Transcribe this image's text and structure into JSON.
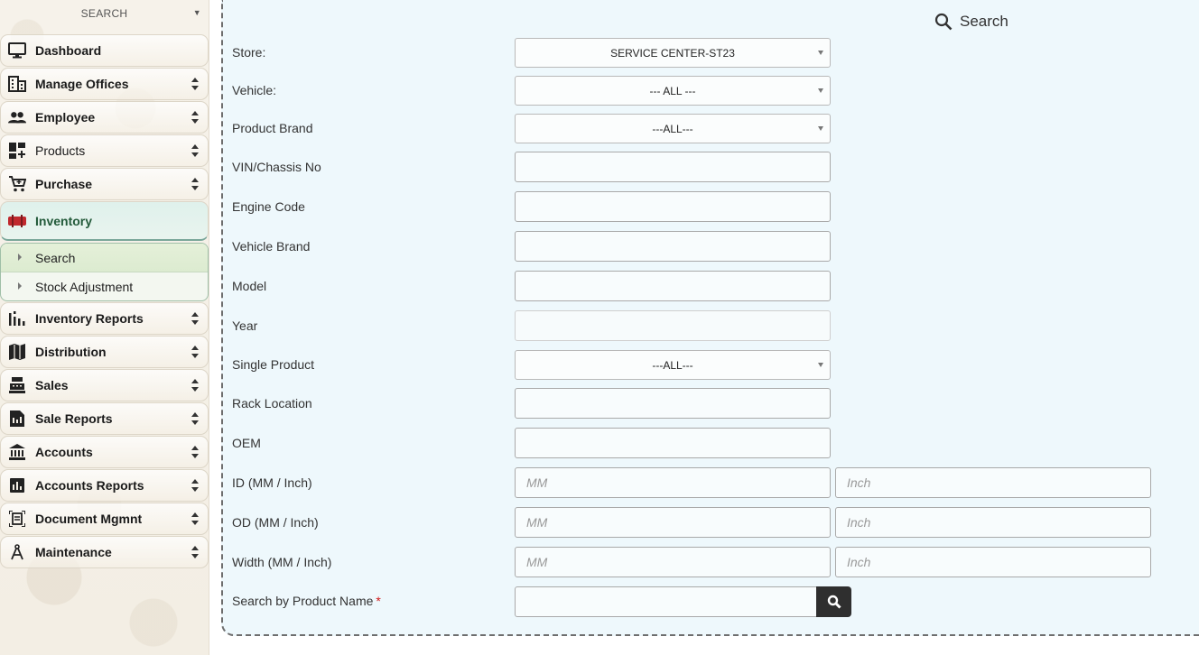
{
  "sidebar": {
    "search_label": "SEARCH",
    "items": [
      {
        "label": "Dashboard",
        "icon": "monitor-icon"
      },
      {
        "label": "Manage Offices",
        "icon": "building-icon"
      },
      {
        "label": "Employee",
        "icon": "people-icon"
      },
      {
        "label": "Products",
        "icon": "dashboard-add-icon"
      },
      {
        "label": "Purchase",
        "icon": "cart-icon"
      },
      {
        "label": "Inventory",
        "icon": "inventory-icon"
      },
      {
        "label": "Inventory Reports",
        "icon": "bar-chart-icon"
      },
      {
        "label": "Distribution",
        "icon": "map-icon"
      },
      {
        "label": "Sales",
        "icon": "cash-register-icon"
      },
      {
        "label": "Sale Reports",
        "icon": "report-file-icon"
      },
      {
        "label": "Accounts",
        "icon": "bank-icon"
      },
      {
        "label": "Accounts Reports",
        "icon": "chart-box-icon"
      },
      {
        "label": "Document Mgmnt",
        "icon": "document-icon"
      },
      {
        "label": "Maintenance",
        "icon": "compass-icon"
      }
    ],
    "submenu": [
      {
        "label": "Search"
      },
      {
        "label": "Stock Adjustment"
      }
    ]
  },
  "panel": {
    "title": "Search",
    "fields": {
      "store": {
        "label": "Store:",
        "value": "SERVICE CENTER-ST23"
      },
      "vehicle": {
        "label": "Vehicle:",
        "value": "--- ALL ---"
      },
      "product_brand": {
        "label": "Product Brand",
        "value": "---ALL---"
      },
      "vin": {
        "label": "VIN/Chassis No",
        "value": ""
      },
      "engine_code": {
        "label": "Engine Code",
        "value": ""
      },
      "vehicle_brand": {
        "label": "Vehicle Brand",
        "value": ""
      },
      "model": {
        "label": "Model",
        "value": ""
      },
      "year": {
        "label": "Year",
        "value": ""
      },
      "single_product": {
        "label": "Single Product",
        "value": "---ALL---"
      },
      "rack_location": {
        "label": "Rack Location",
        "value": ""
      },
      "oem": {
        "label": "OEM",
        "value": ""
      },
      "id_dim": {
        "label": "ID (MM / Inch)",
        "mm_placeholder": "MM",
        "inch_placeholder": "Inch"
      },
      "od_dim": {
        "label": "OD (MM / Inch)",
        "mm_placeholder": "MM",
        "inch_placeholder": "Inch"
      },
      "width_dim": {
        "label": "Width (MM / Inch)",
        "mm_placeholder": "MM",
        "inch_placeholder": "Inch"
      },
      "product_name": {
        "label": "Search by Product Name",
        "required_mark": "*",
        "value": ""
      }
    }
  },
  "colors": {
    "panel_bg": "#eef8fc",
    "active_nav": "#235a3a",
    "inventory_icon": "#c0282d",
    "required": "#d01919",
    "search_button": "#2f2f2f"
  }
}
